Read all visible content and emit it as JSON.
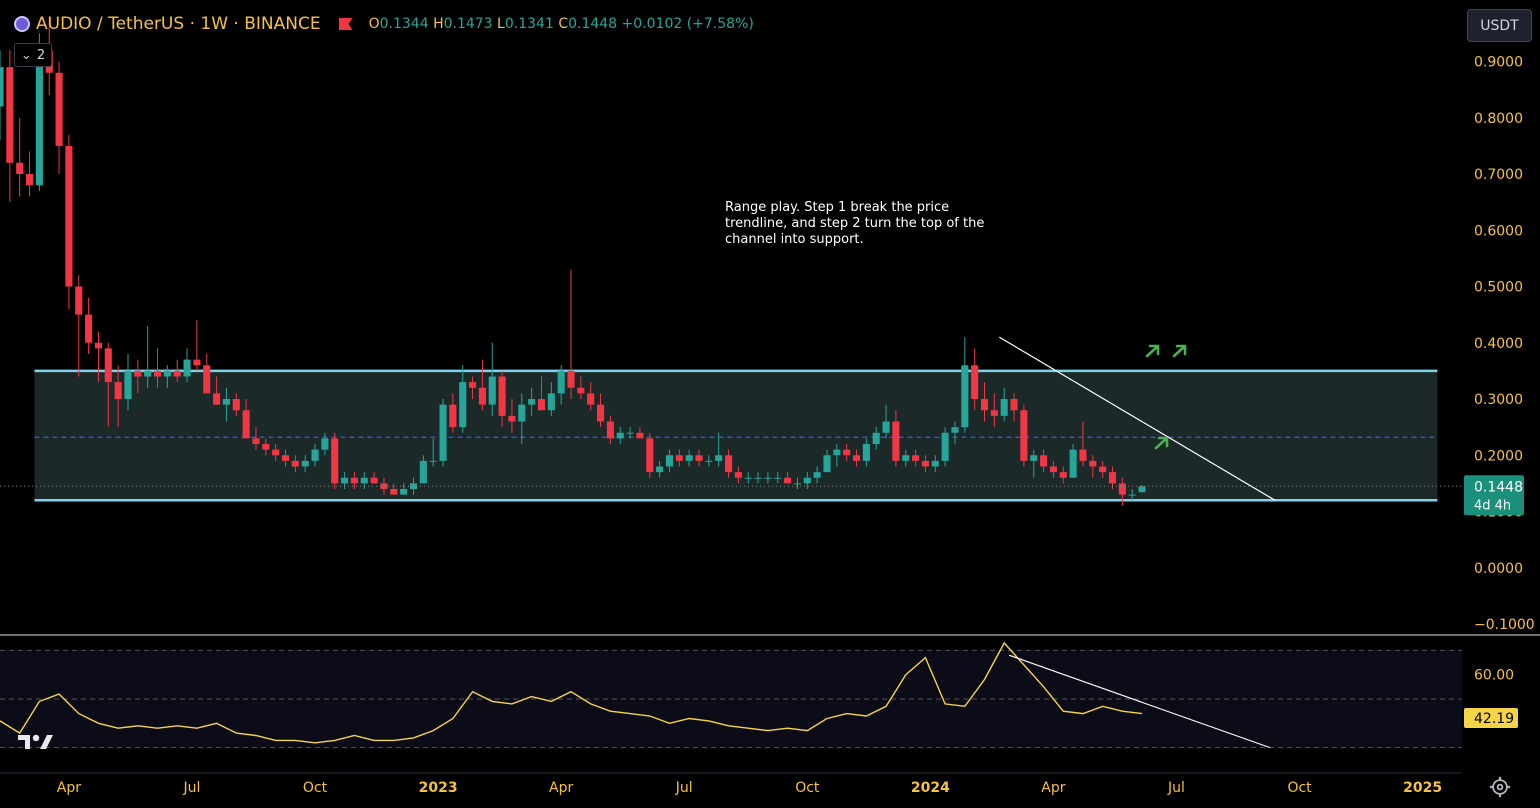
{
  "header": {
    "symbol": "AUDIO / TetherUS · 1W · BINANCE",
    "o_label": "O",
    "o": "0.1344",
    "h_label": "H",
    "h": "0.1473",
    "l_label": "L",
    "l": "0.1341",
    "c_label": "C",
    "c": "0.1448",
    "change": "+0.0102 (+7.58%)",
    "collapse_count": "2",
    "currency": "USDT"
  },
  "annotation": {
    "text": "Range play. Step 1 break the price trendline, and step 2 turn the top of the channel into support."
  },
  "colors": {
    "up": "#26a69a",
    "down": "#f23645",
    "channel": "#7fd3e8",
    "channel_fill": "#1f2d2e",
    "mid": "#3b5bdb",
    "rsi": "#f5d547",
    "axis_text": "#f5c242",
    "arrow": "#4caf50"
  },
  "chart_data": [
    {
      "type": "candlestick",
      "ylim": [
        -0.1,
        1.0
      ],
      "y_ticks": [
        "0.9000",
        "0.8000",
        "0.7000",
        "0.6000",
        "0.5000",
        "0.4000",
        "0.3000",
        "0.2000",
        "0.1000",
        "0.0000",
        "−0.1000"
      ],
      "x_ticks": [
        "Apr",
        "Jul",
        "Oct",
        "2023",
        "Apr",
        "Jul",
        "Oct",
        "2024",
        "Apr",
        "Jul",
        "Oct",
        "2025"
      ],
      "x_tick_dates": [
        2022.25,
        2022.5,
        2022.75,
        2023.0,
        2023.25,
        2023.5,
        2023.75,
        2024.0,
        2024.25,
        2024.5,
        2024.75,
        2025.0
      ],
      "xlim": [
        2022.11,
        2025.08
      ],
      "last_price": "0.1448",
      "countdown": "4d 4h",
      "channel": {
        "top": 0.35,
        "bottom": 0.12,
        "mid": 0.232,
        "start": 2022.18,
        "end": 2025.03
      },
      "trendline": {
        "x": [
          2024.14,
          2024.7
        ],
        "y": [
          0.41,
          0.12
        ]
      },
      "candles": [
        [
          2022.11,
          0.82,
          0.92,
          0.76,
          0.89
        ],
        [
          2022.13,
          0.89,
          0.92,
          0.65,
          0.72
        ],
        [
          2022.15,
          0.72,
          0.8,
          0.66,
          0.7
        ],
        [
          2022.17,
          0.7,
          0.74,
          0.66,
          0.68
        ],
        [
          2022.19,
          0.68,
          0.95,
          0.67,
          0.92
        ],
        [
          2022.21,
          0.92,
          0.98,
          0.84,
          0.88
        ],
        [
          2022.23,
          0.88,
          0.9,
          0.7,
          0.75
        ],
        [
          2022.25,
          0.75,
          0.77,
          0.46,
          0.5
        ],
        [
          2022.27,
          0.5,
          0.52,
          0.34,
          0.45
        ],
        [
          2022.29,
          0.45,
          0.48,
          0.38,
          0.4
        ],
        [
          2022.31,
          0.4,
          0.42,
          0.33,
          0.39
        ],
        [
          2022.33,
          0.39,
          0.4,
          0.25,
          0.33
        ],
        [
          2022.35,
          0.33,
          0.36,
          0.25,
          0.3
        ],
        [
          2022.37,
          0.3,
          0.38,
          0.28,
          0.35
        ],
        [
          2022.39,
          0.35,
          0.37,
          0.31,
          0.34
        ],
        [
          2022.41,
          0.34,
          0.43,
          0.32,
          0.35
        ],
        [
          2022.43,
          0.35,
          0.39,
          0.32,
          0.34
        ],
        [
          2022.45,
          0.34,
          0.36,
          0.32,
          0.35
        ],
        [
          2022.47,
          0.35,
          0.37,
          0.33,
          0.34
        ],
        [
          2022.49,
          0.34,
          0.39,
          0.33,
          0.37
        ],
        [
          2022.51,
          0.37,
          0.44,
          0.35,
          0.36
        ],
        [
          2022.53,
          0.36,
          0.38,
          0.33,
          0.31
        ],
        [
          2022.55,
          0.31,
          0.34,
          0.29,
          0.29
        ],
        [
          2022.57,
          0.29,
          0.32,
          0.26,
          0.3
        ],
        [
          2022.59,
          0.3,
          0.31,
          0.27,
          0.28
        ],
        [
          2022.61,
          0.28,
          0.3,
          0.23,
          0.23
        ],
        [
          2022.63,
          0.23,
          0.25,
          0.21,
          0.22
        ],
        [
          2022.65,
          0.22,
          0.23,
          0.2,
          0.21
        ],
        [
          2022.67,
          0.21,
          0.22,
          0.19,
          0.2
        ],
        [
          2022.69,
          0.2,
          0.21,
          0.18,
          0.19
        ],
        [
          2022.71,
          0.19,
          0.2,
          0.17,
          0.18
        ],
        [
          2022.73,
          0.18,
          0.2,
          0.17,
          0.19
        ],
        [
          2022.75,
          0.19,
          0.22,
          0.18,
          0.21
        ],
        [
          2022.77,
          0.21,
          0.24,
          0.2,
          0.23
        ],
        [
          2022.79,
          0.23,
          0.24,
          0.14,
          0.15
        ],
        [
          2022.81,
          0.15,
          0.17,
          0.14,
          0.16
        ],
        [
          2022.83,
          0.16,
          0.17,
          0.14,
          0.15
        ],
        [
          2022.85,
          0.15,
          0.17,
          0.14,
          0.16
        ],
        [
          2022.87,
          0.16,
          0.17,
          0.15,
          0.15
        ],
        [
          2022.89,
          0.15,
          0.16,
          0.13,
          0.14
        ],
        [
          2022.91,
          0.14,
          0.15,
          0.13,
          0.13
        ],
        [
          2022.93,
          0.13,
          0.15,
          0.13,
          0.14
        ],
        [
          2022.95,
          0.14,
          0.16,
          0.13,
          0.15
        ],
        [
          2022.97,
          0.15,
          0.2,
          0.15,
          0.19
        ],
        [
          2022.99,
          0.19,
          0.23,
          0.18,
          0.19
        ],
        [
          2023.01,
          0.19,
          0.3,
          0.18,
          0.29
        ],
        [
          2023.03,
          0.29,
          0.31,
          0.24,
          0.25
        ],
        [
          2023.05,
          0.25,
          0.36,
          0.24,
          0.33
        ],
        [
          2023.07,
          0.33,
          0.34,
          0.3,
          0.32
        ],
        [
          2023.09,
          0.32,
          0.37,
          0.28,
          0.29
        ],
        [
          2023.11,
          0.29,
          0.4,
          0.27,
          0.34
        ],
        [
          2023.13,
          0.34,
          0.35,
          0.25,
          0.27
        ],
        [
          2023.15,
          0.27,
          0.3,
          0.24,
          0.26
        ],
        [
          2023.17,
          0.26,
          0.31,
          0.22,
          0.29
        ],
        [
          2023.19,
          0.29,
          0.32,
          0.27,
          0.3
        ],
        [
          2023.21,
          0.3,
          0.34,
          0.28,
          0.28
        ],
        [
          2023.23,
          0.28,
          0.33,
          0.27,
          0.31
        ],
        [
          2023.25,
          0.31,
          0.36,
          0.29,
          0.35
        ],
        [
          2023.27,
          0.35,
          0.53,
          0.3,
          0.32
        ],
        [
          2023.29,
          0.32,
          0.34,
          0.3,
          0.31
        ],
        [
          2023.31,
          0.31,
          0.33,
          0.28,
          0.29
        ],
        [
          2023.33,
          0.29,
          0.31,
          0.25,
          0.26
        ],
        [
          2023.35,
          0.26,
          0.27,
          0.22,
          0.23
        ],
        [
          2023.37,
          0.23,
          0.25,
          0.22,
          0.24
        ],
        [
          2023.39,
          0.24,
          0.25,
          0.23,
          0.24
        ],
        [
          2023.41,
          0.24,
          0.25,
          0.23,
          0.23
        ],
        [
          2023.43,
          0.23,
          0.24,
          0.16,
          0.17
        ],
        [
          2023.45,
          0.17,
          0.19,
          0.16,
          0.18
        ],
        [
          2023.47,
          0.18,
          0.21,
          0.17,
          0.2
        ],
        [
          2023.49,
          0.2,
          0.21,
          0.18,
          0.19
        ],
        [
          2023.51,
          0.19,
          0.21,
          0.18,
          0.2
        ],
        [
          2023.53,
          0.2,
          0.21,
          0.18,
          0.19
        ],
        [
          2023.55,
          0.19,
          0.2,
          0.18,
          0.19
        ],
        [
          2023.57,
          0.19,
          0.24,
          0.18,
          0.2
        ],
        [
          2023.59,
          0.2,
          0.21,
          0.16,
          0.17
        ],
        [
          2023.61,
          0.17,
          0.18,
          0.15,
          0.16
        ],
        [
          2023.63,
          0.16,
          0.17,
          0.15,
          0.16
        ],
        [
          2023.65,
          0.16,
          0.17,
          0.15,
          0.16
        ],
        [
          2023.67,
          0.16,
          0.17,
          0.15,
          0.16
        ],
        [
          2023.69,
          0.16,
          0.17,
          0.15,
          0.16
        ],
        [
          2023.71,
          0.16,
          0.17,
          0.15,
          0.15
        ],
        [
          2023.73,
          0.15,
          0.16,
          0.14,
          0.15
        ],
        [
          2023.75,
          0.15,
          0.17,
          0.14,
          0.16
        ],
        [
          2023.77,
          0.16,
          0.18,
          0.15,
          0.17
        ],
        [
          2023.79,
          0.17,
          0.21,
          0.17,
          0.2
        ],
        [
          2023.81,
          0.2,
          0.22,
          0.18,
          0.21
        ],
        [
          2023.83,
          0.21,
          0.22,
          0.19,
          0.2
        ],
        [
          2023.85,
          0.2,
          0.21,
          0.18,
          0.19
        ],
        [
          2023.87,
          0.19,
          0.23,
          0.18,
          0.22
        ],
        [
          2023.89,
          0.22,
          0.25,
          0.21,
          0.24
        ],
        [
          2023.91,
          0.24,
          0.29,
          0.23,
          0.26
        ],
        [
          2023.93,
          0.26,
          0.28,
          0.18,
          0.19
        ],
        [
          2023.95,
          0.19,
          0.21,
          0.18,
          0.2
        ],
        [
          2023.97,
          0.2,
          0.21,
          0.18,
          0.19
        ],
        [
          2023.99,
          0.19,
          0.2,
          0.17,
          0.18
        ],
        [
          2024.01,
          0.18,
          0.2,
          0.17,
          0.19
        ],
        [
          2024.03,
          0.19,
          0.25,
          0.18,
          0.24
        ],
        [
          2024.05,
          0.24,
          0.26,
          0.22,
          0.25
        ],
        [
          2024.07,
          0.25,
          0.41,
          0.24,
          0.36
        ],
        [
          2024.09,
          0.36,
          0.39,
          0.28,
          0.3
        ],
        [
          2024.11,
          0.3,
          0.33,
          0.26,
          0.28
        ],
        [
          2024.13,
          0.28,
          0.31,
          0.25,
          0.27
        ],
        [
          2024.15,
          0.27,
          0.32,
          0.26,
          0.3
        ],
        [
          2024.17,
          0.3,
          0.31,
          0.26,
          0.28
        ],
        [
          2024.19,
          0.28,
          0.29,
          0.18,
          0.19
        ],
        [
          2024.21,
          0.19,
          0.21,
          0.16,
          0.2
        ],
        [
          2024.23,
          0.2,
          0.21,
          0.17,
          0.18
        ],
        [
          2024.25,
          0.18,
          0.19,
          0.16,
          0.17
        ],
        [
          2024.27,
          0.17,
          0.18,
          0.15,
          0.16
        ],
        [
          2024.29,
          0.16,
          0.22,
          0.16,
          0.21
        ],
        [
          2024.31,
          0.21,
          0.26,
          0.18,
          0.19
        ],
        [
          2024.33,
          0.19,
          0.2,
          0.16,
          0.18
        ],
        [
          2024.35,
          0.18,
          0.19,
          0.16,
          0.17
        ],
        [
          2024.37,
          0.17,
          0.18,
          0.14,
          0.15
        ],
        [
          2024.39,
          0.15,
          0.16,
          0.11,
          0.13
        ],
        [
          2024.41,
          0.13,
          0.14,
          0.12,
          0.13
        ],
        [
          2024.43,
          0.1344,
          0.1473,
          0.1341,
          0.1448
        ]
      ]
    },
    {
      "type": "line",
      "name": "RSI",
      "ylim": [
        20,
        80
      ],
      "y_ticks": [
        "60.00"
      ],
      "last_value": "42.19",
      "x": [
        2022.11,
        2022.15,
        2022.19,
        2022.23,
        2022.27,
        2022.31,
        2022.35,
        2022.39,
        2022.43,
        2022.47,
        2022.51,
        2022.55,
        2022.59,
        2022.63,
        2022.67,
        2022.71,
        2022.75,
        2022.79,
        2022.83,
        2022.87,
        2022.91,
        2022.95,
        2022.99,
        2023.03,
        2023.07,
        2023.11,
        2023.15,
        2023.19,
        2023.23,
        2023.27,
        2023.31,
        2023.35,
        2023.39,
        2023.43,
        2023.47,
        2023.51,
        2023.55,
        2023.59,
        2023.63,
        2023.67,
        2023.71,
        2023.75,
        2023.79,
        2023.83,
        2023.87,
        2023.91,
        2023.95,
        2023.99,
        2024.03,
        2024.07,
        2024.11,
        2024.15,
        2024.19,
        2024.23,
        2024.27,
        2024.31,
        2024.35,
        2024.39,
        2024.43
      ],
      "y": [
        41,
        36,
        49,
        52,
        44,
        40,
        38,
        39,
        38,
        39,
        38,
        40,
        36,
        35,
        33,
        33,
        32,
        33,
        35,
        33,
        33,
        34,
        37,
        42,
        53,
        49,
        48,
        51,
        49,
        53,
        48,
        45,
        44,
        43,
        40,
        42,
        41,
        39,
        38,
        37,
        38,
        37,
        42,
        44,
        43,
        47,
        60,
        67,
        48,
        47,
        58,
        73,
        64,
        55,
        45,
        44,
        47,
        45,
        44
      ]
    }
  ]
}
